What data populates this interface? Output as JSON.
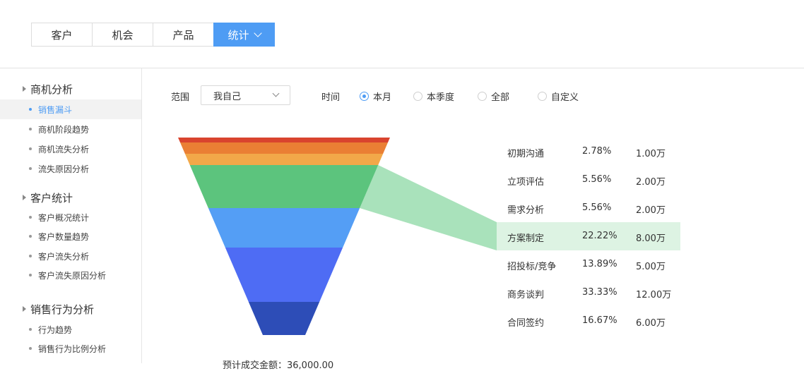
{
  "tabs": [
    {
      "label": "客户",
      "active": false
    },
    {
      "label": "机会",
      "active": false
    },
    {
      "label": "产品",
      "active": false
    },
    {
      "label": "统计",
      "active": true
    }
  ],
  "sidebar": {
    "groups": [
      {
        "title": "商机分析",
        "items": [
          {
            "label": "销售漏斗",
            "active": true
          },
          {
            "label": "商机阶段趋势",
            "active": false
          },
          {
            "label": "商机流失分析",
            "active": false
          },
          {
            "label": "流失原因分析",
            "active": false
          }
        ]
      },
      {
        "title": "客户统计",
        "items": [
          {
            "label": "客户概况统计",
            "active": false
          },
          {
            "label": "客户数量趋势",
            "active": false
          },
          {
            "label": "客户流失分析",
            "active": false
          },
          {
            "label": "客户流失原因分析",
            "active": false
          }
        ]
      },
      {
        "title": "销售行为分析",
        "items": [
          {
            "label": "行为趋势",
            "active": false
          },
          {
            "label": "销售行为比例分析",
            "active": false
          }
        ]
      }
    ]
  },
  "filter": {
    "scope_label": "范围",
    "scope_value": "我自己",
    "time_label": "时间",
    "time_options": [
      {
        "label": "本月",
        "selected": true
      },
      {
        "label": "本季度",
        "selected": false
      },
      {
        "label": "全部",
        "selected": false
      },
      {
        "label": "自定义",
        "selected": false
      }
    ]
  },
  "funnel": {
    "highlighted_stage": "方案制定",
    "stages": [
      {
        "name": "初期沟通",
        "percent": "2.78%",
        "amount": "1.00万",
        "color": "#d9442e"
      },
      {
        "name": "立项评估",
        "percent": "5.56%",
        "amount": "2.00万",
        "color": "#ea7f34"
      },
      {
        "name": "需求分析",
        "percent": "5.56%",
        "amount": "2.00万",
        "color": "#f2a849"
      },
      {
        "name": "方案制定",
        "percent": "22.22%",
        "amount": "8.00万",
        "color": "#5cc47d"
      },
      {
        "name": "招投标/竞争",
        "percent": "13.89%",
        "amount": "5.00万",
        "color": "#549ef5"
      },
      {
        "name": "商务谈判",
        "percent": "33.33%",
        "amount": "12.00万",
        "color": "#4e6cf4"
      },
      {
        "name": "合同签约",
        "percent": "16.67%",
        "amount": "6.00万",
        "color": "#2d4db7"
      }
    ]
  },
  "bottom_text": "预计成交金额：36,000.00"
}
